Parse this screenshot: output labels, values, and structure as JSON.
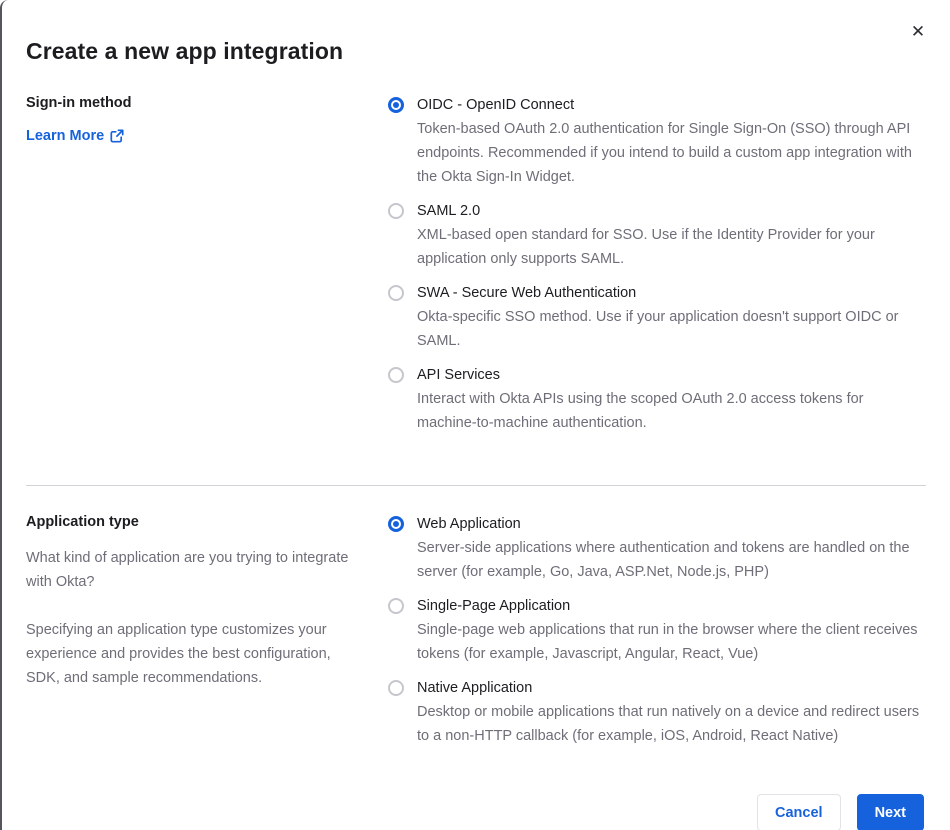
{
  "dialog": {
    "title": "Create a new app integration",
    "close_icon": "✕"
  },
  "signin": {
    "heading": "Sign-in method",
    "learn_more_label": "Learn More",
    "options": [
      {
        "label": "OIDC - OpenID Connect",
        "description": "Token-based OAuth 2.0 authentication for Single Sign-On (SSO) through API endpoints. Recommended if you intend to build a custom app integration with the Okta Sign-In Widget.",
        "selected": true
      },
      {
        "label": "SAML 2.0",
        "description": "XML-based open standard for SSO. Use if the Identity Provider for your application only supports SAML.",
        "selected": false
      },
      {
        "label": "SWA - Secure Web Authentication",
        "description": "Okta-specific SSO method. Use if your application doesn't support OIDC or SAML.",
        "selected": false
      },
      {
        "label": "API Services",
        "description": "Interact with Okta APIs using the scoped OAuth 2.0 access tokens for machine-to-machine authentication.",
        "selected": false
      }
    ]
  },
  "apptype": {
    "heading": "Application type",
    "paragraphs": {
      "p1": "What kind of application are you trying to integrate with Okta?",
      "p2": "Specifying an application type customizes your experience and provides the best configuration, SDK, and sample recommendations."
    },
    "options": [
      {
        "label": "Web Application",
        "description": "Server-side applications where authentication and tokens are handled on the server (for example, Go, Java, ASP.Net, Node.js, PHP)",
        "selected": true
      },
      {
        "label": "Single-Page Application",
        "description": "Single-page web applications that run in the browser where the client receives tokens (for example, Javascript, Angular, React, Vue)",
        "selected": false
      },
      {
        "label": "Native Application",
        "description": "Desktop or mobile applications that run natively on a device and redirect users to a non-HTTP callback (for example, iOS, Android, React Native)",
        "selected": false
      }
    ]
  },
  "footer": {
    "cancel_label": "Cancel",
    "next_label": "Next"
  },
  "colors": {
    "primary_blue": "#1662dd",
    "text_dark": "#1d1d21",
    "text_gray": "#6e6e78",
    "divider": "#d2d2d7"
  }
}
